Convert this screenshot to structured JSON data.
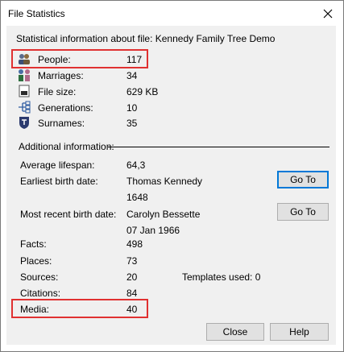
{
  "window": {
    "title": "File Statistics"
  },
  "header": {
    "description": "Statistical information about file: Kennedy Family Tree Demo"
  },
  "stats": [
    {
      "icon": "people-icon",
      "label": "People:",
      "value": "117"
    },
    {
      "icon": "marriages-icon",
      "label": "Marriages:",
      "value": "34"
    },
    {
      "icon": "file-size-icon",
      "label": "File size:",
      "value": "629 KB"
    },
    {
      "icon": "generations-icon",
      "label": "Generations:",
      "value": "10"
    },
    {
      "icon": "surnames-icon",
      "label": "Surnames:",
      "value": "35"
    }
  ],
  "additional": {
    "heading": "Additional information:",
    "avg_lifespan_label": "Average lifespan:",
    "avg_lifespan_value": "64,3",
    "earliest_label": "Earliest birth date:",
    "earliest_name": "Thomas Kennedy",
    "earliest_date": "1648",
    "recent_label": "Most recent birth date:",
    "recent_name": "Carolyn Bessette",
    "recent_date": "07 Jan 1966",
    "goto_label": "Go To",
    "facts_label": "Facts:",
    "facts_value": "498",
    "places_label": "Places:",
    "places_value": "73",
    "sources_label": "Sources:",
    "sources_value": "20",
    "templates_label": "Templates used: 0",
    "citations_label": "Citations:",
    "citations_value": "84",
    "media_label": "Media:",
    "media_value": "40"
  },
  "buttons": {
    "close": "Close",
    "help": "Help"
  },
  "colors": {
    "highlight": "#e03131",
    "focus": "#0078d7",
    "client_bg": "#f0f0f0"
  }
}
